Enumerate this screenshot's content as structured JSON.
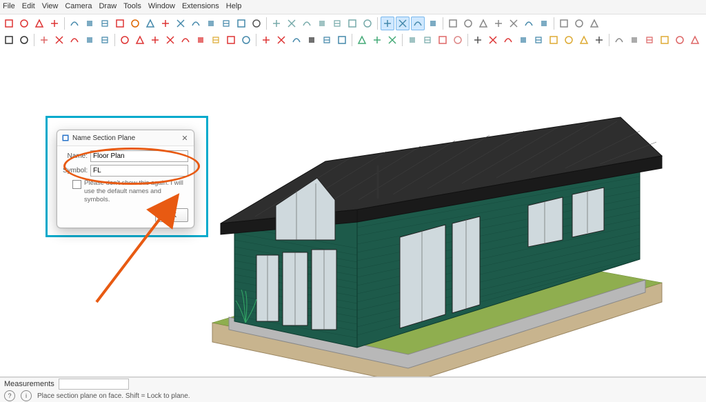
{
  "menu": [
    "File",
    "Edit",
    "View",
    "Camera",
    "Draw",
    "Tools",
    "Window",
    "Extensions",
    "Help"
  ],
  "dialog": {
    "title": "Name Section Plane",
    "name_label": "Name:",
    "name_value": "Floor Plan",
    "symbol_label": "Symbol:",
    "symbol_value": "FL",
    "checkbox_text": "Please don't show this again.  I will use the default names and symbols.",
    "ok": "OK"
  },
  "status": {
    "measurements_label": "Measurements",
    "tip": "Place section plane on face.  Shift = Lock to plane."
  },
  "toolbar_rows": [
    [
      {
        "n": "button-a",
        "c": "#d33"
      },
      {
        "n": "button-b",
        "c": "#d33"
      },
      {
        "n": "button-c",
        "c": "#d33"
      },
      {
        "n": "button-d",
        "c": "#d33"
      },
      {
        "n": "sep"
      },
      {
        "n": "tool-a",
        "c": "#48a"
      },
      {
        "n": "tool-b",
        "c": "#48a"
      },
      {
        "n": "tool-c",
        "c": "#48a"
      },
      {
        "n": "tool-d",
        "c": "#d33"
      },
      {
        "n": "tool-e",
        "c": "#d60"
      },
      {
        "n": "tool-f",
        "c": "#48a"
      },
      {
        "n": "tool-g",
        "c": "#d33"
      },
      {
        "n": "tool-h",
        "c": "#48a"
      },
      {
        "n": "tool-i",
        "c": "#48a"
      },
      {
        "n": "tool-j",
        "c": "#48a"
      },
      {
        "n": "tool-k",
        "c": "#48a"
      },
      {
        "n": "tool-l",
        "c": "#48a"
      },
      {
        "n": "walk-icon",
        "c": "#555"
      },
      {
        "n": "sep"
      },
      {
        "n": "plan-a",
        "c": "#7aa"
      },
      {
        "n": "plan-b",
        "c": "#7aa"
      },
      {
        "n": "plan-c",
        "c": "#7aa"
      },
      {
        "n": "plan-d",
        "c": "#7aa"
      },
      {
        "n": "plan-e",
        "c": "#7aa"
      },
      {
        "n": "plan-f",
        "c": "#7aa"
      },
      {
        "n": "plan-g",
        "c": "#7aa"
      },
      {
        "n": "sep"
      },
      {
        "n": "layer-a",
        "c": "#48a",
        "active": true
      },
      {
        "n": "layer-b",
        "c": "#48a",
        "active": true
      },
      {
        "n": "layer-c",
        "c": "#48a",
        "active": true
      },
      {
        "n": "layer-d",
        "c": "#48a"
      },
      {
        "n": "sep"
      },
      {
        "n": "shade-a",
        "c": "#888"
      },
      {
        "n": "shade-b",
        "c": "#888"
      },
      {
        "n": "shade-c",
        "c": "#888"
      },
      {
        "n": "shade-d",
        "c": "#888"
      },
      {
        "n": "shade-e",
        "c": "#888"
      },
      {
        "n": "shade-f",
        "c": "#48a"
      },
      {
        "n": "shade-g",
        "c": "#48a"
      },
      {
        "n": "sep"
      },
      {
        "n": "gear-a",
        "c": "#888"
      },
      {
        "n": "gear-b",
        "c": "#888"
      },
      {
        "n": "gear-c",
        "c": "#888"
      }
    ],
    [
      {
        "n": "zoom-icon",
        "c": "#333"
      },
      {
        "n": "select-icon",
        "c": "#333"
      },
      {
        "n": "sep"
      },
      {
        "n": "erase-a",
        "c": "#d66"
      },
      {
        "n": "erase-b",
        "c": "#d33"
      },
      {
        "n": "erase-c",
        "c": "#d33"
      },
      {
        "n": "erase-d",
        "c": "#48a"
      },
      {
        "n": "erase-e",
        "c": "#48a"
      },
      {
        "n": "sep"
      },
      {
        "n": "draw-a",
        "c": "#d33"
      },
      {
        "n": "draw-b",
        "c": "#d33"
      },
      {
        "n": "draw-c",
        "c": "#d33"
      },
      {
        "n": "draw-d",
        "c": "#d33"
      },
      {
        "n": "draw-e",
        "c": "#d33"
      },
      {
        "n": "draw-f",
        "c": "#d33"
      },
      {
        "n": "warn-icon",
        "c": "#da3"
      },
      {
        "n": "move-a",
        "c": "#d33"
      },
      {
        "n": "move-b",
        "c": "#48a"
      },
      {
        "n": "sep"
      },
      {
        "n": "orbit-a",
        "c": "#d33"
      },
      {
        "n": "orbit-b",
        "c": "#d33"
      },
      {
        "n": "orbit-c",
        "c": "#48a"
      },
      {
        "n": "orbit-d",
        "c": "#333"
      },
      {
        "n": "orbit-e",
        "c": "#48a"
      },
      {
        "n": "orbit-f",
        "c": "#48a"
      },
      {
        "n": "sep"
      },
      {
        "n": "stack-a",
        "c": "#4a7"
      },
      {
        "n": "stack-b",
        "c": "#4a7"
      },
      {
        "n": "stack-c",
        "c": "#4a7"
      },
      {
        "n": "sep"
      },
      {
        "n": "page-a",
        "c": "#7aa"
      },
      {
        "n": "page-b",
        "c": "#7aa"
      },
      {
        "n": "page-c",
        "c": "#d66"
      },
      {
        "n": "page-d",
        "c": "#d88"
      },
      {
        "n": "sep"
      },
      {
        "n": "line-a",
        "c": "#555"
      },
      {
        "n": "line-b",
        "c": "#d33"
      },
      {
        "n": "line-c",
        "c": "#d33"
      },
      {
        "n": "line-d",
        "c": "#48a"
      },
      {
        "n": "line-e",
        "c": "#48a"
      },
      {
        "n": "tape-a",
        "c": "#da3"
      },
      {
        "n": "tape-b",
        "c": "#da3"
      },
      {
        "n": "tape-c",
        "c": "#da3"
      },
      {
        "n": "tape-d",
        "c": "#555"
      },
      {
        "n": "sep"
      },
      {
        "n": "ext-a",
        "c": "#888"
      },
      {
        "n": "ext-b",
        "c": "#888"
      },
      {
        "n": "ext-c",
        "c": "#d66"
      },
      {
        "n": "ext-d",
        "c": "#da3"
      },
      {
        "n": "ext-e",
        "c": "#d66"
      },
      {
        "n": "ext-f",
        "c": "#d66"
      }
    ]
  ]
}
